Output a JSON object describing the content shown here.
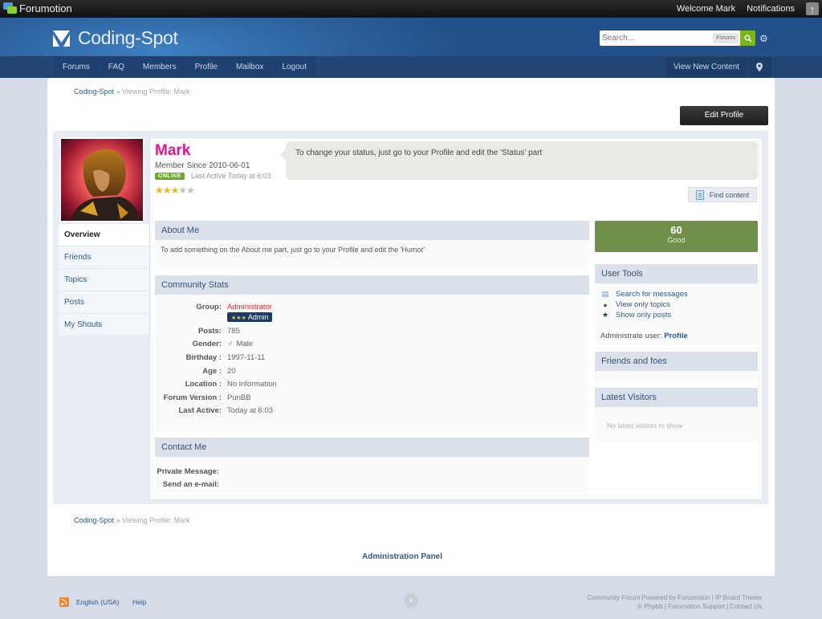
{
  "topbar": {
    "brand": "Forumotion",
    "welcome": "Welcome Mark",
    "notifications": "Notifications",
    "scroll_up_icon": "arrow-up-icon"
  },
  "header": {
    "site_name": "Coding-Spot",
    "search": {
      "placeholder": "Search...",
      "scope": "Forums",
      "button_icon": "search-icon",
      "settings_icon": "gear-icon"
    }
  },
  "nav": {
    "items": [
      {
        "label": "Forums"
      },
      {
        "label": "FAQ"
      },
      {
        "label": "Members"
      },
      {
        "label": "Profile"
      },
      {
        "label": "Mailbox"
      },
      {
        "label": "Logout"
      }
    ],
    "view_new_content": "View New Content",
    "map_icon": "map-pin-icon"
  },
  "breadcrumb": {
    "root": "Coding-Spot",
    "separator": "»",
    "current": "Viewing Profile: Mark"
  },
  "edit_profile_label": "Edit Profile",
  "profile": {
    "username": "Mark",
    "username_color": "#e0158c",
    "member_since": "Member Since 2010-06-01",
    "online_badge": "ONLINE",
    "last_active": "Last Active Today at 6:03",
    "rating": {
      "filled": 3,
      "total": 5
    },
    "status": "To change your status, just go to your Profile and edit the 'Status' part",
    "find_content": "Find content"
  },
  "side_tabs": [
    {
      "label": "Overview",
      "active": true
    },
    {
      "label": "Friends",
      "active": false
    },
    {
      "label": "Topics",
      "active": false
    },
    {
      "label": "Posts",
      "active": false
    },
    {
      "label": "My Shouts",
      "active": false
    }
  ],
  "about": {
    "title": "About Me",
    "text": "To add something on the About me part, just go to your Profile and edit the 'Humor'"
  },
  "community_stats": {
    "title": "Community Stats",
    "group_label": "Group:",
    "group_value": "Administrator",
    "rank_badge": "Admin",
    "rows": [
      {
        "label": "Posts:",
        "value": "785"
      },
      {
        "label": "Gender:",
        "value": "Male"
      },
      {
        "label": "Birthday :",
        "value": "1997-11-11"
      },
      {
        "label": "Age :",
        "value": "20"
      },
      {
        "label": "Location :",
        "value": "No information"
      },
      {
        "label": "Forum Version :",
        "value": "PunBB"
      },
      {
        "label": "Last Active:",
        "value": "Today at 6:03"
      }
    ]
  },
  "contact": {
    "title": "Contact Me",
    "rows": [
      {
        "label": "Private Message:"
      },
      {
        "label": "Send an e-mail:"
      }
    ]
  },
  "reputation": {
    "value": "60",
    "label": "Good",
    "color": "#6f8f4a"
  },
  "user_tools": {
    "title": "User Tools",
    "items": [
      {
        "label": "Search for messages",
        "icon": "document-icon"
      },
      {
        "label": "View only topics",
        "icon": "chat-bubble-icon"
      },
      {
        "label": "Show only posts",
        "icon": "star-icon"
      }
    ],
    "administrate_label": "Administrate user:",
    "administrate_link": "Profile"
  },
  "friends_foes": {
    "title": "Friends and foes"
  },
  "latest_visitors": {
    "title": "Latest Visitors",
    "empty": "No latest visitors to show"
  },
  "admin_panel": "Administration Panel",
  "footer": {
    "language": "English (USA)",
    "help": "Help",
    "copyright_line1": "Community Forum Powered by Forumotion | IP Board Theme",
    "copyright_line2": "© Phpbb | Forumotion Support | Contact Us"
  }
}
